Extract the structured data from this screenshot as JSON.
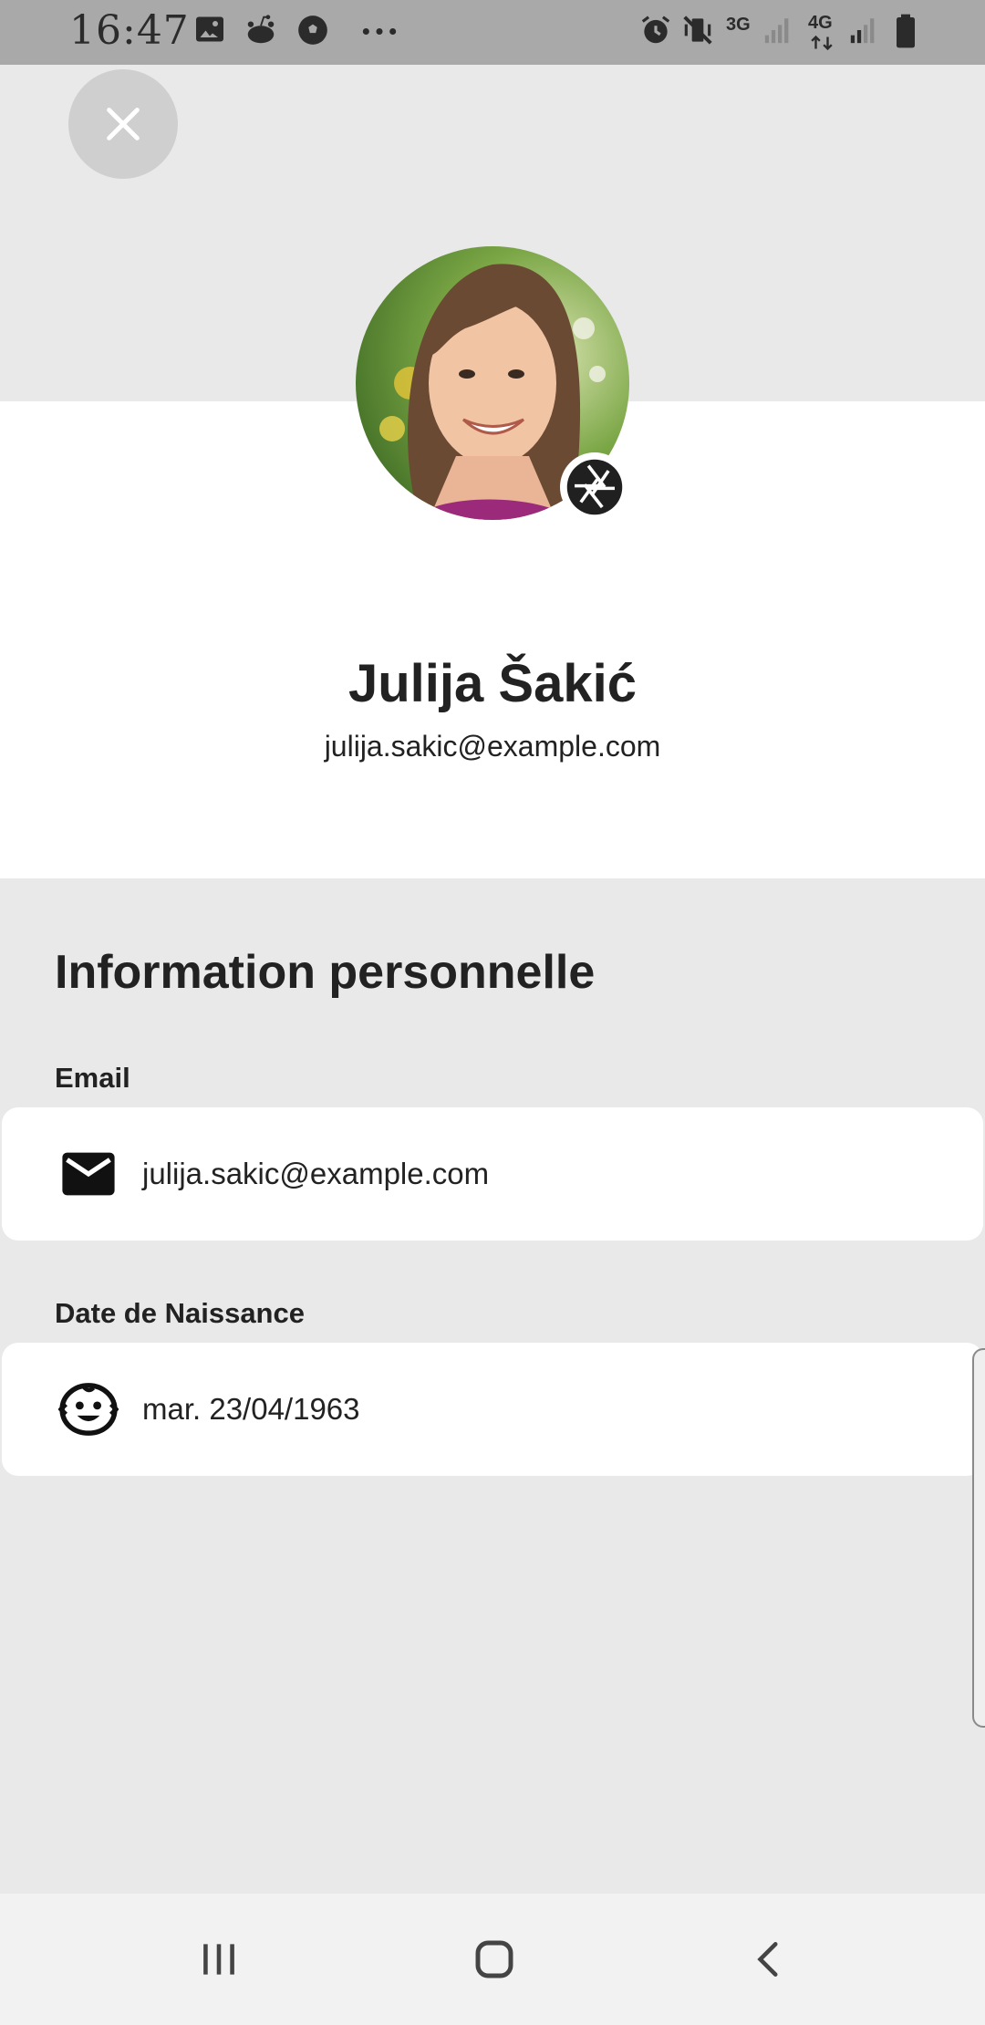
{
  "status_bar": {
    "time": "16:47",
    "left_icons": [
      "gallery-icon",
      "reddit-icon",
      "soccer-ball-icon",
      "more-dots-icon"
    ],
    "right_icons": [
      "alarm-icon",
      "vibrate-mute-icon",
      "signal-3g-icon",
      "signal-4g-icon",
      "battery-icon"
    ],
    "network_1": "3G",
    "network_2": "4G"
  },
  "header": {
    "close_icon": "close-icon",
    "avatar_alt": "profile photo",
    "camera_icon": "camera-aperture-icon"
  },
  "profile": {
    "name": "Julija Šakić",
    "email": "julija.sakic@example.com"
  },
  "section": {
    "title": "Information personnelle"
  },
  "fields": [
    {
      "label": "Email",
      "icon": "mail-icon",
      "value": "julija.sakic@example.com"
    },
    {
      "label": "Date de Naissance",
      "icon": "baby-face-icon",
      "value": "mar. 23/04/1963"
    }
  ],
  "nav_bar": {
    "buttons": [
      "recent-apps-icon",
      "home-icon",
      "back-icon"
    ]
  },
  "colors": {
    "status_bar_bg": "#a9a9a9",
    "page_bg": "#e9e9e9",
    "card_bg": "#ffffff",
    "text": "#222222"
  }
}
